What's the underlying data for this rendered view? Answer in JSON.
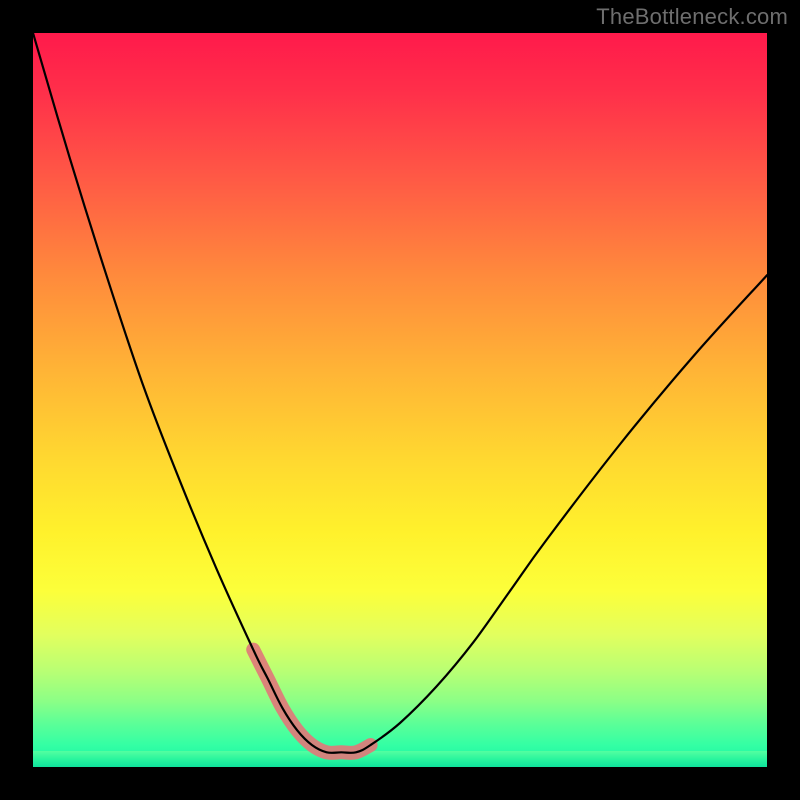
{
  "watermark": "TheBottleneck.com",
  "chart_data": {
    "type": "line",
    "title": "",
    "xlabel": "",
    "ylabel": "",
    "xlim": [
      0,
      100
    ],
    "ylim": [
      0,
      100
    ],
    "grid": false,
    "legend": false,
    "x": [
      0,
      5,
      10,
      15,
      20,
      25,
      30,
      32,
      34,
      36,
      38,
      40,
      42,
      44,
      46,
      50,
      55,
      60,
      65,
      70,
      80,
      90,
      100
    ],
    "series": [
      {
        "name": "bottleneck-curve",
        "values": [
          100,
          83,
          67,
          52,
          39,
          27,
          16,
          12,
          8,
          5,
          3,
          2,
          2,
          2,
          3,
          6,
          11,
          17,
          24,
          31,
          44,
          56,
          67
        ]
      }
    ],
    "highlight": {
      "name": "optimal-range",
      "x": [
        30,
        32,
        34,
        36,
        38,
        40,
        42,
        44,
        46
      ],
      "values": [
        16,
        12,
        8,
        5,
        3,
        2,
        2,
        2,
        3
      ]
    },
    "background_gradient": {
      "stops": [
        {
          "pos": 0,
          "color": "#ff1a4b"
        },
        {
          "pos": 50,
          "color": "#ffd830"
        },
        {
          "pos": 78,
          "color": "#fcff3a"
        },
        {
          "pos": 100,
          "color": "#14f2a4"
        }
      ]
    }
  }
}
